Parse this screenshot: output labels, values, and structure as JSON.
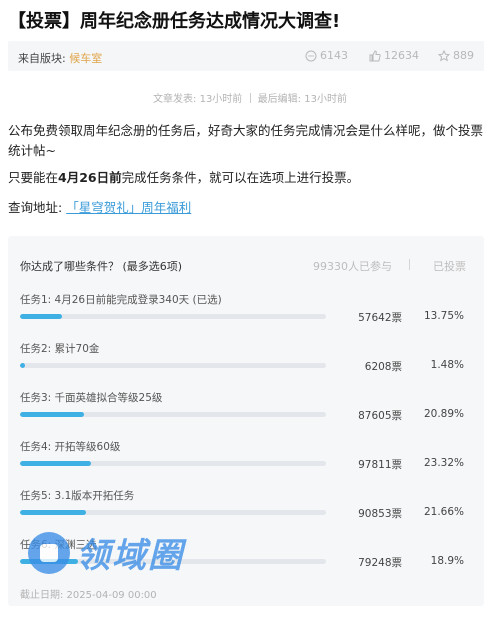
{
  "title": "【投票】周年纪念册任务达成情况大调查!",
  "meta": {
    "section_label": "来自版块:",
    "section_link": "候车室",
    "comments": "6143",
    "likes": "12634",
    "favorites": "889"
  },
  "times": {
    "published": "文章发表: 13小时前",
    "edited": "最后编辑: 13小时前"
  },
  "content": {
    "p1": "公布免费领取周年纪念册的任务后，好奇大家的任务完成情况会是什么样呢，做个投票统计帖~",
    "p2_prefix": "只要能在",
    "p2_bold": "4月26日前",
    "p2_suffix": "完成任务条件，就可以在选项上进行投票。",
    "p3_prefix": "查询地址: ",
    "p3_link": "「星穹贺礼」周年福利"
  },
  "vote": {
    "question": "你达成了哪些条件？ (最多选6项)",
    "participants": "99330人已参与",
    "voted": "已投票",
    "options": [
      {
        "label": "任务1: 4月26日前能完成登录340天 (已选)",
        "votes": "57642票",
        "percent": "13.75%",
        "pct_value": 13.75
      },
      {
        "label": "任务2: 累计70金",
        "votes": "6208票",
        "percent": "1.48%",
        "pct_value": 1.48
      },
      {
        "label": "任务3: 千面英雄拟合等级25级",
        "votes": "87605票",
        "percent": "20.89%",
        "pct_value": 20.89
      },
      {
        "label": "任务4: 开拓等级60级",
        "votes": "97811票",
        "percent": "23.32%",
        "pct_value": 23.32
      },
      {
        "label": "任务5: 3.1版本开拓任务",
        "votes": "90853票",
        "percent": "21.66%",
        "pct_value": 21.66
      },
      {
        "label": "任务6: 深渊三选",
        "votes": "79248票",
        "percent": "18.9%",
        "pct_value": 18.9
      }
    ],
    "deadline": "截止日期: 2025-04-09 00:00"
  },
  "watermark": {
    "text": "领域圈",
    "color": "#3a8ee6"
  },
  "colors": {
    "accent_fill": "#3fb0e3",
    "link": "#3a9bd9",
    "section_link": "#e0a54a"
  }
}
